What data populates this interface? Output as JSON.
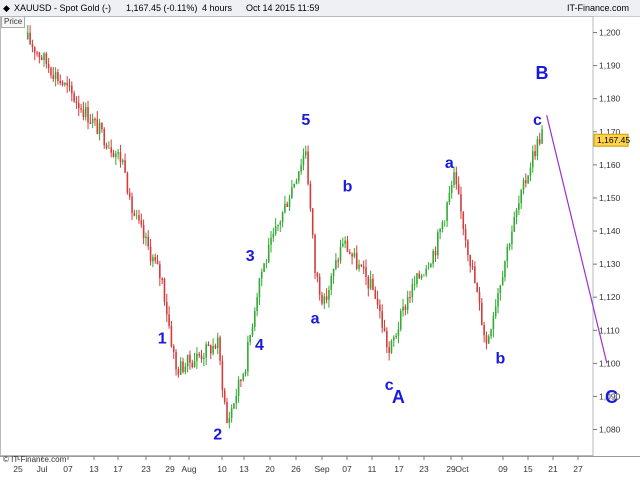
{
  "header": {
    "symbol": "XAUUSD - Spot Gold (-)",
    "price": "1,167.45 (-0.11%)",
    "timeframe": "4 hours",
    "timestamp": "Oct 14 2015 11:59",
    "brand": "IT-Finance.com"
  },
  "price_tag": "Price",
  "footer_brand": "© IT-Finance.com",
  "colors": {
    "up": "#33aa33",
    "down": "#d43c3c",
    "wave_labels": "#1a1adc",
    "projection": "#9933cc",
    "last_price_box": "#ffd24d"
  },
  "chart_data": {
    "type": "line",
    "ylim": [
      1072,
      1205
    ],
    "y_ticks": [
      "1,080",
      "1,090",
      "1,100",
      "1,110",
      "1,120",
      "1,130",
      "1,140",
      "1,150",
      "1,160",
      "1,170",
      "1,180",
      "1,190",
      "1,200"
    ],
    "x_ticks": [
      "25",
      "Jul",
      "07",
      "13",
      "17",
      "23",
      "29",
      "Aug",
      "10",
      "13",
      "20",
      "26",
      "Sep",
      "07",
      "11",
      "17",
      "23",
      "29",
      "Oct",
      "09",
      "15",
      "21",
      "27"
    ],
    "last_price": "1,167.45",
    "x": [
      "Jun 25",
      "Jul 08",
      "Jul 16",
      "Jul 17",
      "Jul 24",
      "Jul 27",
      "Aug 05",
      "Aug 07",
      "Aug 11",
      "Aug 14",
      "Aug 24",
      "Aug 26",
      "Aug 28",
      "Sep 01",
      "Sep 08",
      "Sep 11",
      "Sep 15",
      "Sep 21",
      "Sep 25",
      "Sep 29",
      "Oct 02",
      "Oct 07",
      "Oct 12",
      "Oct 14"
    ],
    "series": [
      {
        "values": [
          1198,
          1175,
          1160,
          1148,
          1125,
          1098,
          1106,
          1082,
          1100,
          1126,
          1165,
          1128,
          1118,
          1137,
          1121,
          1103,
          1120,
          1135,
          1156,
          1128,
          1106,
          1138,
          1163,
          1170
        ]
      }
    ],
    "annotations": [
      {
        "text": "1",
        "date": "Jul 24",
        "price": 1106
      },
      {
        "text": "2",
        "date": "Aug 05",
        "price": 1077
      },
      {
        "text": "3",
        "date": "Aug 12",
        "price": 1131
      },
      {
        "text": "4",
        "date": "Aug 14",
        "price": 1104
      },
      {
        "text": "5",
        "date": "Aug 24",
        "price": 1172
      },
      {
        "text": "a",
        "date": "Aug 26",
        "price": 1112
      },
      {
        "text": "b",
        "date": "Sep 02",
        "price": 1152
      },
      {
        "text": "c",
        "date": "Sep 11",
        "price": 1092
      },
      {
        "text": "A",
        "date": "Sep 13",
        "price": 1088
      },
      {
        "text": "a",
        "date": "Sep 24",
        "price": 1159
      },
      {
        "text": "b",
        "date": "Oct 05",
        "price": 1100
      },
      {
        "text": "c",
        "date": "Oct 13",
        "price": 1172
      },
      {
        "text": "B",
        "date": "Oct 14",
        "price": 1186
      },
      {
        "text": "C",
        "date": "Oct 29",
        "price": 1088
      }
    ],
    "projection": {
      "from": {
        "date": "Oct 15",
        "price": 1175
      },
      "to": {
        "date": "Oct 28",
        "price": 1100
      }
    }
  }
}
